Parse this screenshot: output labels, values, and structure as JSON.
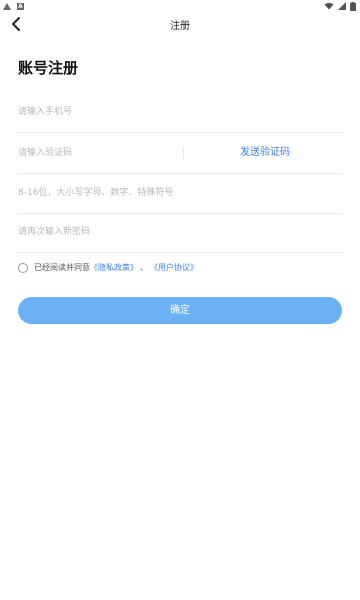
{
  "status_bar": {
    "left_icons": [
      "warning-icon",
      "a-notification-icon"
    ],
    "right_icons": [
      "wifi-icon",
      "signal-icon",
      "battery-icon"
    ]
  },
  "nav": {
    "title": "注册",
    "back_icon": "chevron-left-icon"
  },
  "heading": "账号注册",
  "form": {
    "phone_placeholder": "请输入手机号",
    "code_placeholder": "请输入验证码",
    "send_code_label": "发送验证码",
    "password_placeholder": "8-16位，大小写字母、数字、特殊符号",
    "confirm_password_placeholder": "请再次输入新密码"
  },
  "agreement": {
    "prefix": "已经阅读并同意",
    "privacy_link": "《隐私政策》",
    "separator": "、",
    "user_link": "《用户协议》"
  },
  "confirm_label": "确定",
  "colors": {
    "accent": "#3d7fe0",
    "button": "#6ab0f3"
  }
}
